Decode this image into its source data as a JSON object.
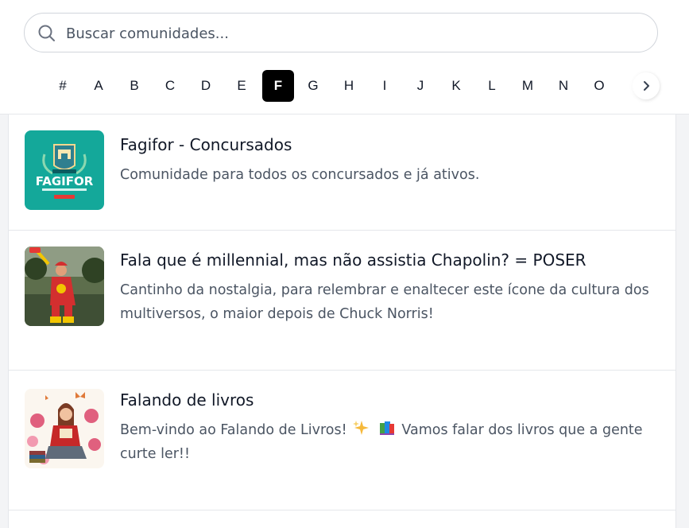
{
  "search": {
    "placeholder": "Buscar comunidades..."
  },
  "alphabet": {
    "letters": [
      "#",
      "A",
      "B",
      "C",
      "D",
      "E",
      "F",
      "G",
      "H",
      "I",
      "J",
      "K",
      "L",
      "M",
      "N",
      "O"
    ],
    "active": "F"
  },
  "communities": [
    {
      "title": "Fagifor - Concursados",
      "description": "Comunidade para todos os concursados e já ativos.",
      "thumb": {
        "banner": "FAGIFOR",
        "colors": {
          "bg": "#14a89a",
          "text": "#ffffff"
        }
      }
    },
    {
      "title": "Fala que é millennial, mas não assistia Chapolin? = POSER",
      "description": "Cantinho da nostalgia, para relembrar e enaltecer este ícone da cultura dos multiversos, o maior depois de Chuck Norris!"
    },
    {
      "title": "Falando de livros",
      "description_prefix": "Bem-vindo ao Falando de Livros!",
      "description_emoji": [
        "sparkles-emoji",
        "books-emoji"
      ],
      "description_suffix": "Vamos falar dos livros que a gente curte ler!!"
    }
  ],
  "colors": {
    "accent": "#000000",
    "teal": "#14a89a",
    "border": "#e5e7eb"
  }
}
